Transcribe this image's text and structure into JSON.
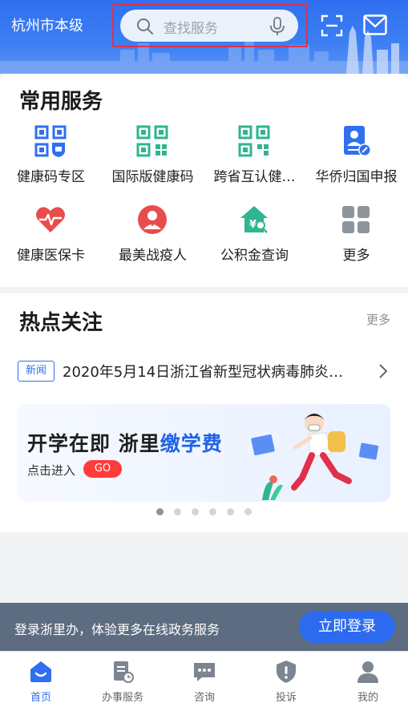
{
  "header": {
    "city": "杭州市本级",
    "search_placeholder": "查找服务"
  },
  "common_services": {
    "title": "常用服务",
    "items": [
      {
        "label": "健康码专区",
        "icon": "health-code-icon"
      },
      {
        "label": "国际版健康码",
        "icon": "qr-code-icon"
      },
      {
        "label": "跨省互认健…",
        "icon": "qr-code-icon"
      },
      {
        "label": "华侨归国申报",
        "icon": "id-card-edit-icon"
      },
      {
        "label": "健康医保卡",
        "icon": "heart-pulse-icon"
      },
      {
        "label": "最美战疫人",
        "icon": "doctor-badge-icon"
      },
      {
        "label": "公积金查询",
        "icon": "house-yuan-icon"
      },
      {
        "label": "更多",
        "icon": "grid-icon"
      }
    ]
  },
  "hot_topics": {
    "title": "热点关注",
    "more": "更多",
    "news_tag": "新闻",
    "news_text": "2020年5月14日浙江省新型冠状病毒肺炎…",
    "banner": {
      "title_part1": "开学在即 浙里",
      "title_part2": "缴学费",
      "subtitle": "点击进入",
      "go_label": "GO"
    },
    "carousel_count": 6,
    "carousel_active": 1
  },
  "login_bar": {
    "text": "登录浙里办，体验更多在线政务服务",
    "button": "立即登录"
  },
  "tabbar": {
    "tabs": [
      {
        "label": "首页",
        "icon": "home-icon",
        "active": true
      },
      {
        "label": "办事服务",
        "icon": "service-doc-icon",
        "active": false
      },
      {
        "label": "咨询",
        "icon": "chat-icon",
        "active": false
      },
      {
        "label": "投诉",
        "icon": "shield-alert-icon",
        "active": false
      },
      {
        "label": "我的",
        "icon": "user-icon",
        "active": false
      }
    ]
  },
  "colors": {
    "primary": "#2f6ff0",
    "red": "#e94c4c",
    "green": "#2fb58f",
    "login_bar": "#5d6c80"
  }
}
